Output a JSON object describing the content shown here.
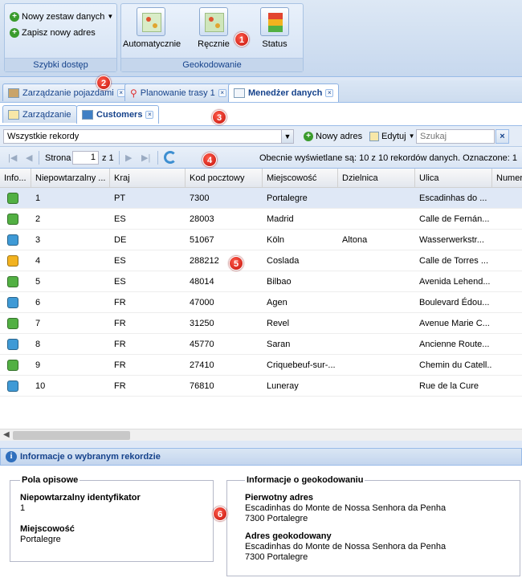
{
  "quick_access": {
    "new_dataset": "Nowy zestaw danych",
    "save_address": "Zapisz nowy adres",
    "title": "Szybki dostęp"
  },
  "geocoding": {
    "automatic": "Automatycznie",
    "manual": "Ręcznie",
    "status": "Status",
    "title": "Geokodowanie"
  },
  "callouts": [
    "1",
    "2",
    "3",
    "4",
    "5",
    "6"
  ],
  "main_tabs": [
    {
      "label": "Zarządzanie pojazdami",
      "active": false
    },
    {
      "label": "Planowanie trasy 1",
      "active": false
    },
    {
      "label": "Menedżer danych",
      "active": true
    }
  ],
  "sub_tabs": [
    {
      "label": "Zarządzanie",
      "active": false
    },
    {
      "label": "Customers",
      "active": true
    }
  ],
  "toolbar": {
    "filter_value": "Wszystkie rekordy",
    "new_address": "Nowy adres",
    "edit": "Edytuj",
    "search_placeholder": "Szukaj",
    "clear": "×"
  },
  "paging": {
    "page_label": "Strona",
    "page_value": "1",
    "of_label": "z 1",
    "summary": "Obecnie wyświetlane są: 10 z 10 rekordów danych. Oznaczone: 1"
  },
  "grid": {
    "columns": [
      "Info...",
      "Niepowtarzalny ...",
      "Kraj",
      "Kod pocztowy",
      "Miejscowość",
      "Dzielnica",
      "Ulica",
      "Numer"
    ],
    "rows": [
      {
        "status": "#52b043",
        "id": "1",
        "country": "PT",
        "zip": "7300",
        "city": "Portalegre",
        "district": "",
        "street": "Escadinhas do ...",
        "selected": true
      },
      {
        "status": "#52b043",
        "id": "2",
        "country": "ES",
        "zip": "28003",
        "city": "Madrid",
        "district": "",
        "street": "Calle de Fernán...",
        "selected": false
      },
      {
        "status": "#3f9ad6",
        "id": "3",
        "country": "DE",
        "zip": "51067",
        "city": "Köln",
        "district": "Altona",
        "street": "Wasserwerkstr...",
        "selected": false
      },
      {
        "status": "#f2b21f",
        "id": "4",
        "country": "ES",
        "zip": "288212",
        "city": "Coslada",
        "district": "",
        "street": "Calle de Torres ...",
        "selected": false
      },
      {
        "status": "#52b043",
        "id": "5",
        "country": "ES",
        "zip": "48014",
        "city": "Bilbao",
        "district": "",
        "street": "Avenida Lehend...",
        "selected": false
      },
      {
        "status": "#3f9ad6",
        "id": "6",
        "country": "FR",
        "zip": "47000",
        "city": "Agen",
        "district": "",
        "street": "Boulevard Édou...",
        "selected": false
      },
      {
        "status": "#52b043",
        "id": "7",
        "country": "FR",
        "zip": "31250",
        "city": "Revel",
        "district": "",
        "street": "Avenue Marie C...",
        "selected": false
      },
      {
        "status": "#3f9ad6",
        "id": "8",
        "country": "FR",
        "zip": "45770",
        "city": "Saran",
        "district": "",
        "street": "Ancienne Route...",
        "selected": false
      },
      {
        "status": "#52b043",
        "id": "9",
        "country": "FR",
        "zip": "27410",
        "city": "Criquebeuf-sur-...",
        "district": "",
        "street": "Chemin du Catell...",
        "selected": false
      },
      {
        "status": "#3f9ad6",
        "id": "10",
        "country": "FR",
        "zip": "76810",
        "city": "Luneray",
        "district": "",
        "street": "Rue de la Cure",
        "selected": false
      }
    ]
  },
  "detail": {
    "title": "Informacje o wybranym rekordzie",
    "descriptive": {
      "legend": "Pola opisowe",
      "id_label": "Niepowtarzalny identyfikator",
      "id_value": "1",
      "city_label": "Miejscowość",
      "city_value": "Portalegre"
    },
    "geocoding": {
      "legend": "Informacje o geokodowaniu",
      "original_label": "Pierwotny adres",
      "original_line1": "Escadinhas do Monte de Nossa Senhora da Penha",
      "original_line2": "7300 Portalegre",
      "geocoded_label": "Adres geokodowany",
      "geocoded_line1": "Escadinhas do Monte de Nossa Senhora da Penha",
      "geocoded_line2": "7300 Portalegre"
    }
  }
}
